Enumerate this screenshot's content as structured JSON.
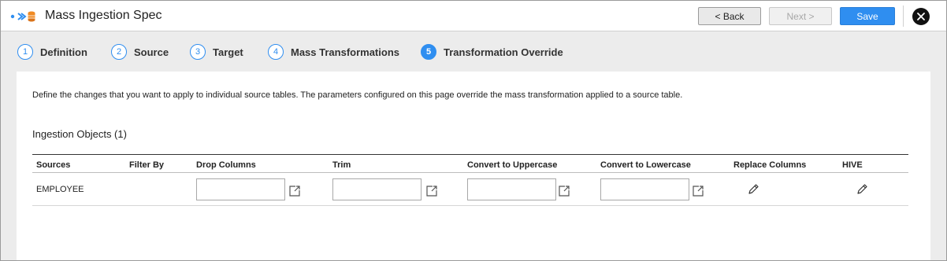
{
  "header": {
    "title": "Mass Ingestion Spec",
    "back_label": "< Back",
    "next_label": "Next >",
    "save_label": "Save",
    "icons": {
      "logo": "mass-ingestion-logo-icon",
      "close": "close-icon"
    }
  },
  "steps": [
    {
      "number": "1",
      "label": "Definition",
      "active": false
    },
    {
      "number": "2",
      "label": "Source",
      "active": false
    },
    {
      "number": "3",
      "label": "Target",
      "active": false
    },
    {
      "number": "4",
      "label": "Mass Transformations",
      "active": false
    },
    {
      "number": "5",
      "label": "Transformation Override",
      "active": true
    }
  ],
  "main": {
    "description": "Define the changes that you want to apply to individual source tables. The parameters configured on this page override the mass transformation applied to a source table.",
    "section_title": "Ingestion Objects (1)",
    "table": {
      "columns": [
        "Sources",
        "Filter By",
        "Drop Columns",
        "Trim",
        "Convert to Uppercase",
        "Convert to Lowercase",
        "Replace Columns",
        "HIVE"
      ],
      "rows": [
        {
          "source": "EMPLOYEE",
          "filter_by": "",
          "drop_columns": "",
          "trim": "",
          "convert_to_uppercase": "",
          "convert_to_lowercase": ""
        }
      ]
    }
  },
  "colors": {
    "accent": "#2f8ef0",
    "background": "#ececec",
    "panel": "#ffffff",
    "close_button": "#111111"
  }
}
